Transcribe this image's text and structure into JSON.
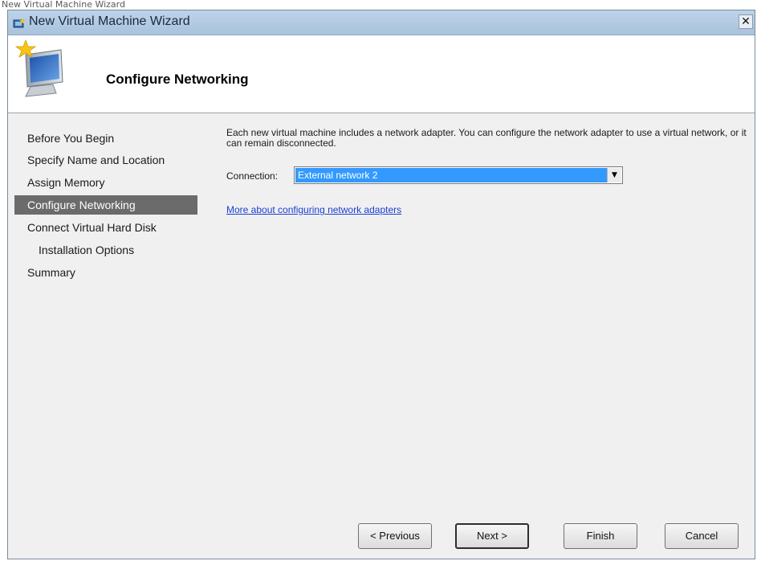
{
  "caption": "New Virtual Machine Wizard",
  "window": {
    "title": "New Virtual Machine Wizard",
    "close_label": "✕"
  },
  "header": {
    "heading": "Configure Networking"
  },
  "nav": {
    "items": [
      {
        "label": "Before You Begin",
        "active": false,
        "indent": false
      },
      {
        "label": "Specify Name and Location",
        "active": false,
        "indent": false
      },
      {
        "label": "Assign Memory",
        "active": false,
        "indent": false
      },
      {
        "label": "Configure Networking",
        "active": true,
        "indent": false
      },
      {
        "label": "Connect Virtual Hard Disk",
        "active": false,
        "indent": false
      },
      {
        "label": "Installation Options",
        "active": false,
        "indent": true
      },
      {
        "label": "Summary",
        "active": false,
        "indent": false
      }
    ]
  },
  "content": {
    "description": "Each new virtual machine includes a network adapter. You can configure the network adapter to use a virtual network, or it can remain disconnected.",
    "connection_label": "Connection:",
    "connection_value": "External network 2",
    "help_link": "More about configuring network adapters"
  },
  "buttons": {
    "previous": "< Previous",
    "next": "Next >",
    "finish": "Finish",
    "cancel": "Cancel"
  },
  "icons": {
    "app": "vm-wizard-icon",
    "hero": "monitor-star-icon",
    "close": "close-icon",
    "dropdown": "chevron-down-icon"
  },
  "colors": {
    "titlebar": "#b3cbe3",
    "selection": "#3399ff",
    "active_nav": "#6b6b6b",
    "link": "#1a3fd4"
  }
}
